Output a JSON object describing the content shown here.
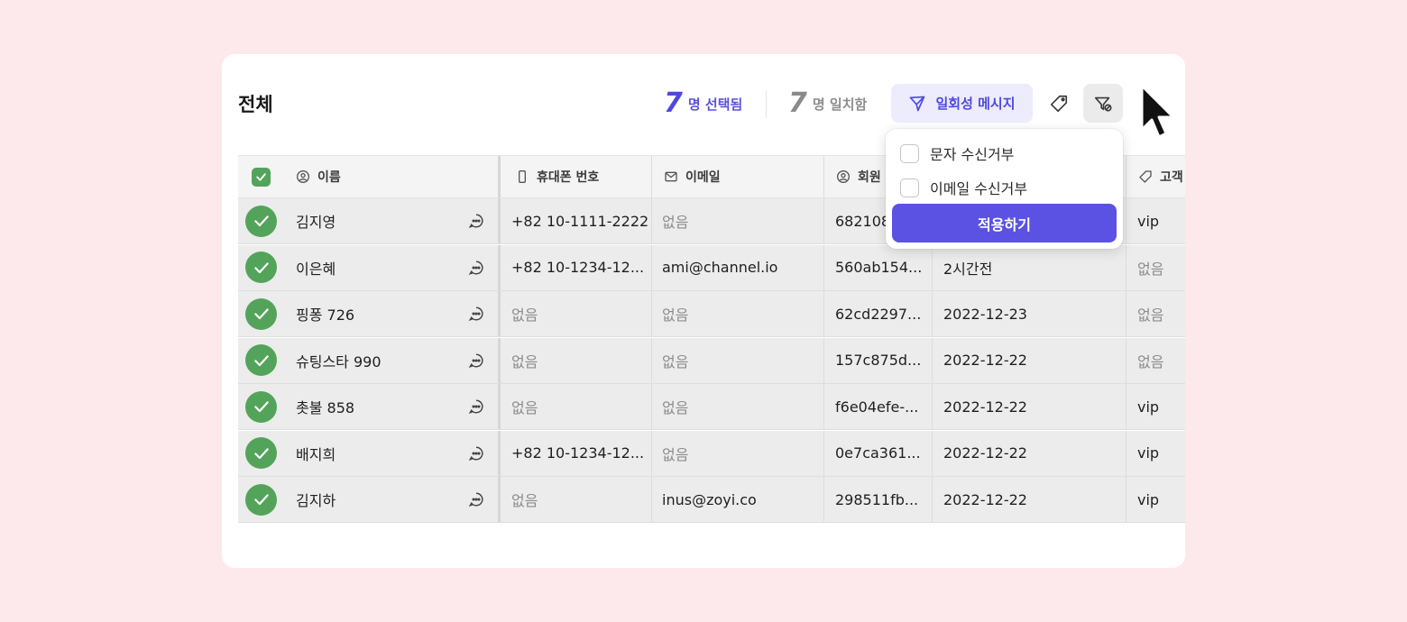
{
  "page": {
    "title": "전체"
  },
  "toolbar": {
    "selected_count": "7",
    "selected_label": "명 선택됨",
    "matched_count": "7",
    "matched_label": "명 일치함",
    "onetime_message_label": "일회성 메시지"
  },
  "table": {
    "columns": [
      {
        "label": "이름",
        "icon": "user-circle-icon"
      },
      {
        "label": "휴대폰 번호",
        "icon": "phone-icon"
      },
      {
        "label": "이메일",
        "icon": "mail-icon"
      },
      {
        "label": "회원",
        "icon": "user-circle-icon"
      },
      {
        "label": "",
        "icon": ""
      },
      {
        "label": "고객",
        "icon": "tag-icon"
      }
    ],
    "rows": [
      {
        "name": "김지영",
        "phone": "+82 10-1111-2222",
        "email": "없음",
        "member": "682108",
        "date": "",
        "tag": "vip"
      },
      {
        "name": "이은혜",
        "phone": "+82 10-1234-12...",
        "email": "ami@channel.io",
        "member": "560ab154...",
        "date": "2시간전",
        "tag": "없음"
      },
      {
        "name": "핑퐁 726",
        "phone": "없음",
        "email": "없음",
        "member": "62cd2297...",
        "date": "2022-12-23",
        "tag": "없음"
      },
      {
        "name": "슈팅스타 990",
        "phone": "없음",
        "email": "없음",
        "member": "157c875d...",
        "date": "2022-12-22",
        "tag": "없음"
      },
      {
        "name": "촛불 858",
        "phone": "없음",
        "email": "없음",
        "member": "f6e04efe-...",
        "date": "2022-12-22",
        "tag": "vip"
      },
      {
        "name": "배지희",
        "phone": "+82 10-1234-12...",
        "email": "없음",
        "member": "0e7ca361...",
        "date": "2022-12-22",
        "tag": "vip"
      },
      {
        "name": "김지하",
        "phone": "없음",
        "email": "inus@zoyi.co",
        "member": "298511fb...",
        "date": "2022-12-22",
        "tag": "vip"
      }
    ]
  },
  "filter_dropdown": {
    "options": [
      {
        "label": "문자 수신거부",
        "checked": false
      },
      {
        "label": "이메일 수신거부",
        "checked": false
      }
    ],
    "apply_label": "적용하기"
  },
  "colors": {
    "accent": "#5b52e3",
    "check_green": "#53a45a",
    "background": "#fde9ec"
  }
}
